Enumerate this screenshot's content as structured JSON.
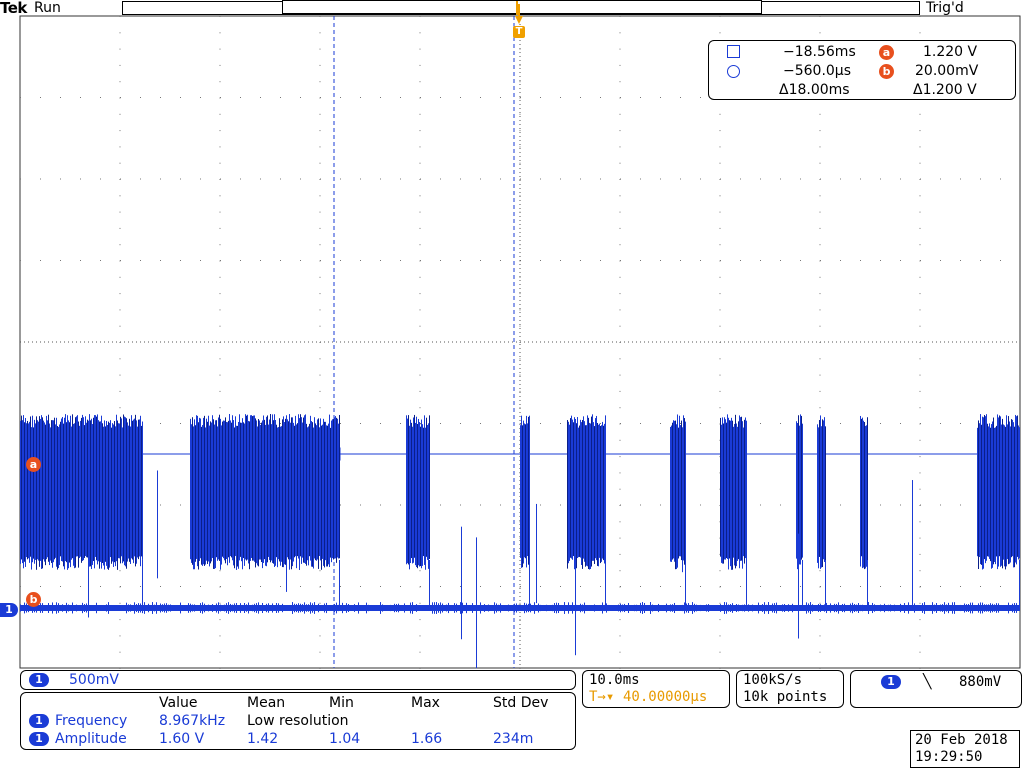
{
  "header": {
    "brand": "Tek",
    "run_state": "Run",
    "trigger_state": "Trig'd"
  },
  "markers": {
    "trigger": "T",
    "ch1": "1",
    "cursor_a": "a",
    "cursor_b": "b"
  },
  "cursor_readout": {
    "square_time": "−18.56ms",
    "circle_time": "−560.0µs",
    "delta_time": "Δ18.00ms",
    "a_value": "1.220 V",
    "b_value": "20.00mV",
    "delta_value": "Δ1.200 V"
  },
  "channel": {
    "number": "1",
    "scale": "500mV"
  },
  "horizontal": {
    "timebase": "10.0ms",
    "delay": "40.00000µs",
    "delay_icon": "T→▾"
  },
  "acquisition": {
    "sample_rate": "100kS/s",
    "record_length": "10k points"
  },
  "trigger_panel": {
    "source": "1",
    "slope_icon": "falling-edge-icon",
    "slope_glyph": "╲",
    "level": "880mV"
  },
  "measurements": {
    "headers": [
      "Value",
      "Mean",
      "Min",
      "Max",
      "Std Dev"
    ],
    "rows": [
      {
        "channel": "1",
        "name": "Frequency",
        "value": "8.967kHz",
        "mean": "Low resolution",
        "min": "",
        "max": "",
        "std": ""
      },
      {
        "channel": "1",
        "name": "Amplitude",
        "value": "1.60 V",
        "mean": "1.42",
        "min": "1.04",
        "max": "1.66",
        "std": "234m"
      }
    ]
  },
  "datetime": {
    "date": "20 Feb  2018",
    "time": "19:29:50"
  },
  "colors": {
    "trace": "#1a3bd6",
    "trace_dark": "#0a1f8a",
    "trigger_marker": "#f0a000",
    "cursor_label": "#e8501e",
    "grid": "#888888"
  }
}
